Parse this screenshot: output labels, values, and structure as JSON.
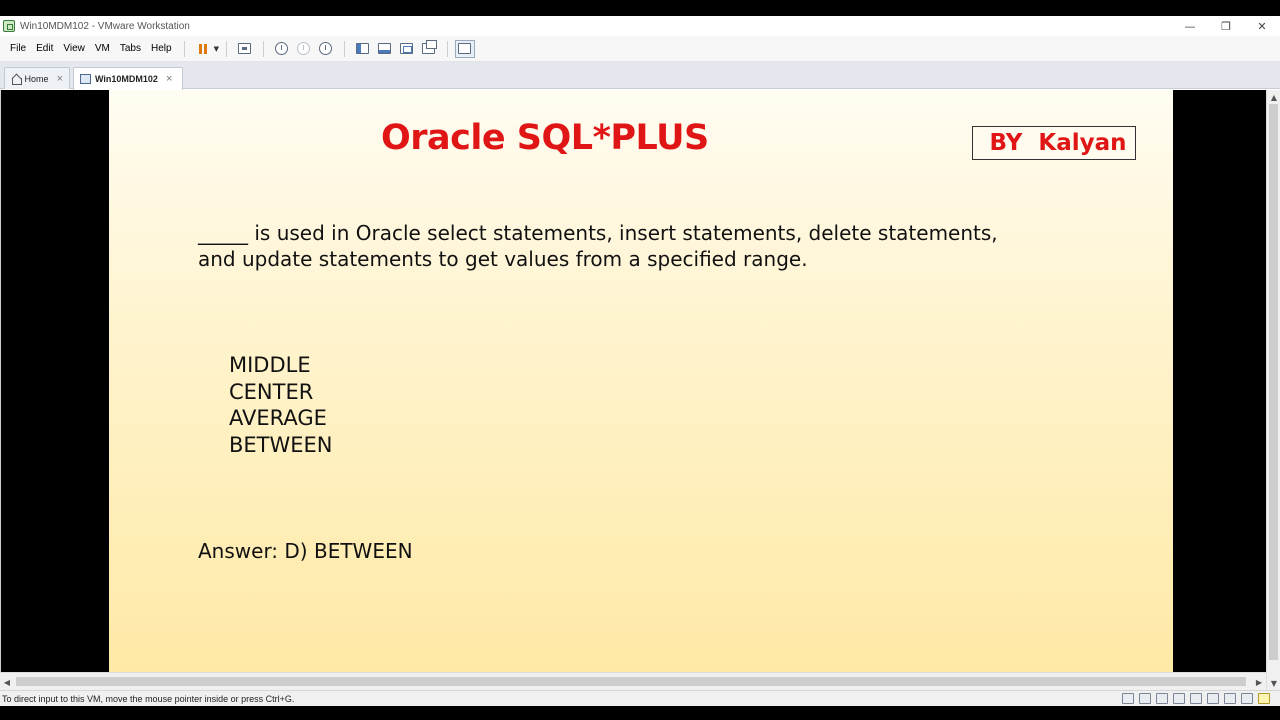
{
  "window": {
    "title": "Win10MDM102 - VMware Workstation",
    "controls": {
      "minimize": "—",
      "restore": "❐",
      "close": "✕"
    }
  },
  "menu": {
    "items": [
      "File",
      "Edit",
      "View",
      "VM",
      "Tabs",
      "Help"
    ]
  },
  "toolbar": {
    "icons": [
      "pause-icon",
      "send-ctrl-alt-del-icon",
      "snapshot-icon",
      "revert-snapshot-icon",
      "snapshot-manager-icon",
      "show-library-icon",
      "thumbnail-bar-icon",
      "full-screen-icon",
      "unity-icon",
      "console-view-icon"
    ]
  },
  "tabs": [
    {
      "label": "Home",
      "close": "×"
    },
    {
      "label": "Win10MDM102",
      "close": "×"
    }
  ],
  "slide": {
    "title": "Oracle SQL*PLUS",
    "byline": " BY  Kalyan",
    "question_line1": "_____ is used in Oracle select statements, insert statements, delete statements,",
    "question_line2": "and update statements to get values from a specified range.",
    "options": [
      "MIDDLE",
      "CENTER",
      "AVERAGE",
      "BETWEEN"
    ],
    "answer": "Answer: D) BETWEEN"
  },
  "status": {
    "text": "To direct input to this VM, move the mouse pointer inside or press Ctrl+G."
  },
  "colors": {
    "title_red": "#e01515",
    "pause_orange": "#e07a10",
    "slide_top": "#fffcf2",
    "slide_bottom": "#ffe9a6"
  }
}
